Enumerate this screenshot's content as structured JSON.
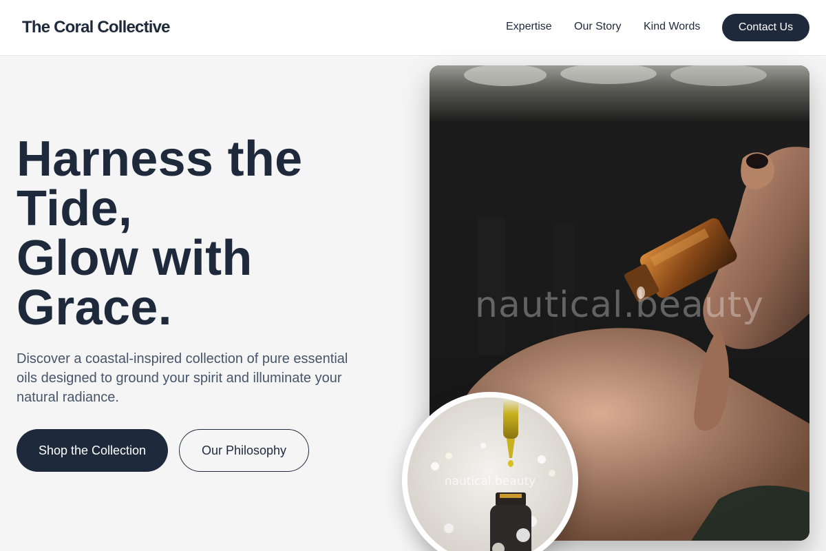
{
  "brand": {
    "name": "The Coral Collective"
  },
  "nav": {
    "items": [
      {
        "label": "Expertise"
      },
      {
        "label": "Our Story"
      },
      {
        "label": "Kind Words"
      }
    ],
    "cta_label": "Contact Us"
  },
  "hero": {
    "headline_lines": [
      "Harness the",
      "Tide,",
      "Glow with",
      "Grace."
    ],
    "subtext": "Discover a coastal-inspired collection of pure essential oils designed to ground your spirit and illuminate your natural radiance.",
    "primary_button": "Shop the Collection",
    "secondary_button": "Our Philosophy",
    "image_watermark": "nautical.beauty",
    "circle_watermark": "nautical.beauty"
  },
  "colors": {
    "primary": "#1e293b",
    "background": "#f5f5f5",
    "muted_text": "#475569"
  }
}
